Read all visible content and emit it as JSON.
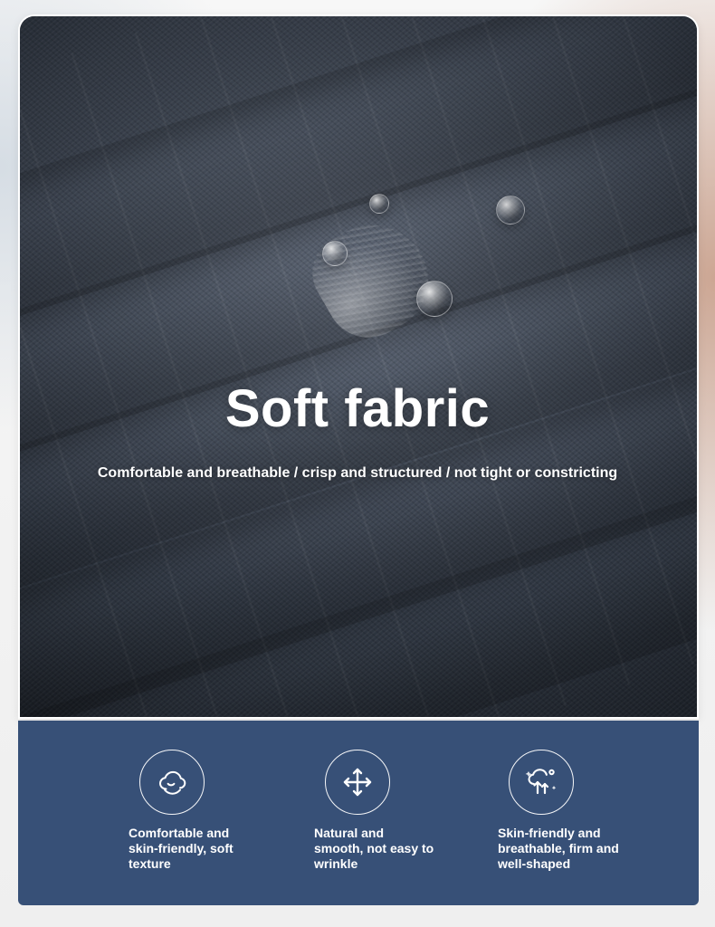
{
  "hero": {
    "title": "Soft fabric",
    "subtitle": "Comfortable and breathable / crisp and structured / not tight or constricting"
  },
  "features": [
    {
      "icon": "cloud-face-icon",
      "text": "Comfortable and\nskin-friendly, soft\ntexture"
    },
    {
      "icon": "move-arrows-icon",
      "text": "Natural and\nsmooth, not easy to\nwrinkle"
    },
    {
      "icon": "airflow-icon",
      "text": "Skin-friendly and\nbreathable, firm and\nwell-shaped"
    }
  ],
  "colors": {
    "feature_panel_bg": "#375077",
    "text_white": "#ffffff"
  }
}
